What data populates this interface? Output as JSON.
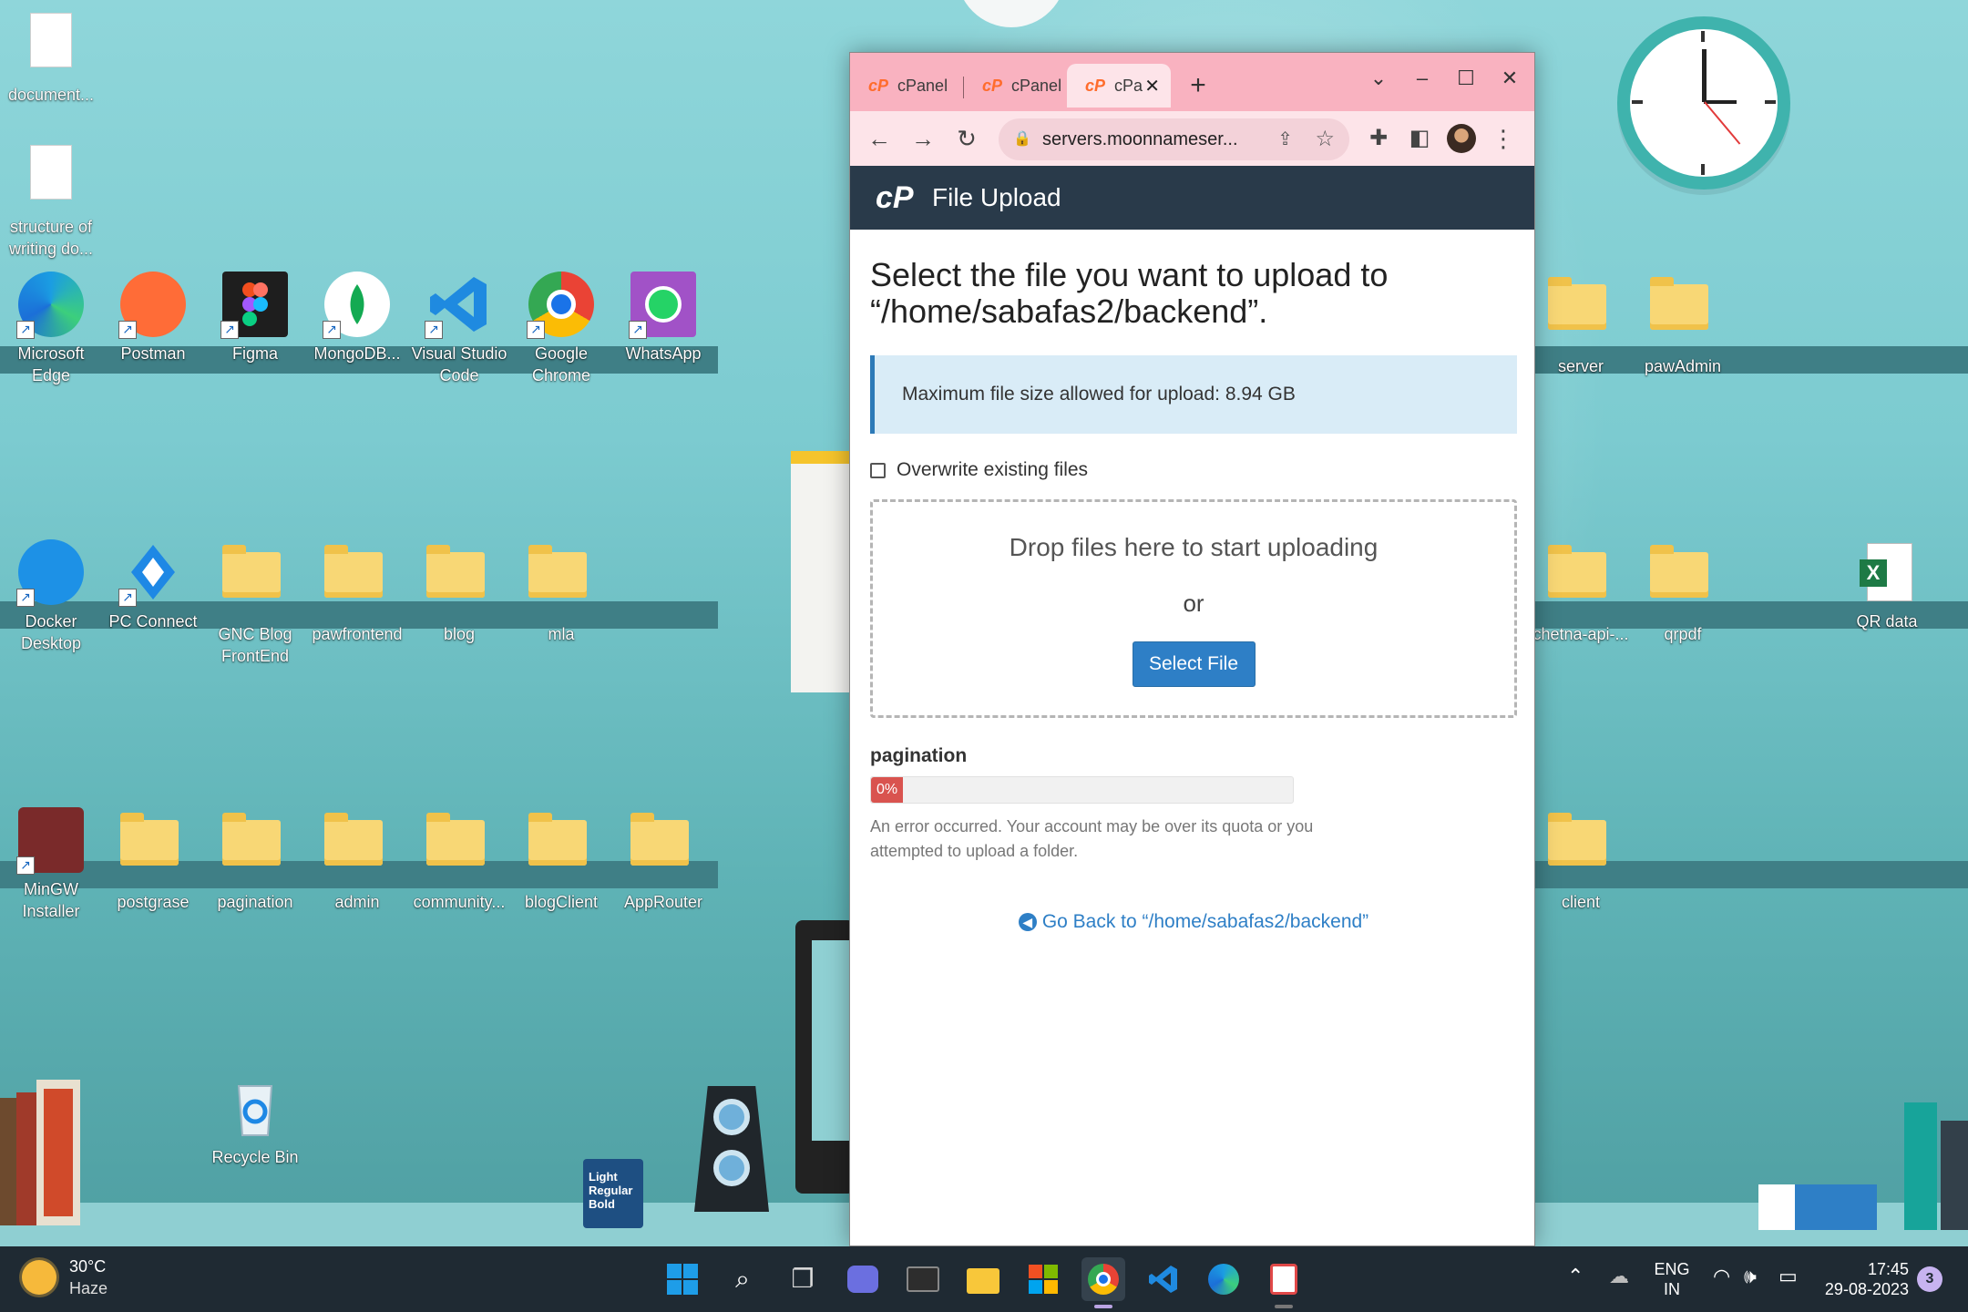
{
  "desktop": {
    "icons": [
      {
        "label": "document..."
      },
      {
        "label": "structure of writing do..."
      },
      {
        "label": "Microsoft Edge"
      },
      {
        "label": "Postman"
      },
      {
        "label": "Figma"
      },
      {
        "label": "MongoDB..."
      },
      {
        "label": "Visual Studio Code"
      },
      {
        "label": "Google Chrome"
      },
      {
        "label": "WhatsApp"
      },
      {
        "label": "Docker Desktop"
      },
      {
        "label": "PC Connect"
      },
      {
        "label": "GNC Blog FrontEnd"
      },
      {
        "label": "pawfrontend"
      },
      {
        "label": "blog"
      },
      {
        "label": "mla"
      },
      {
        "label": "MinGW Installer"
      },
      {
        "label": "postgrase"
      },
      {
        "label": "pagination"
      },
      {
        "label": "admin"
      },
      {
        "label": "community..."
      },
      {
        "label": "blogClient"
      },
      {
        "label": "AppRouter"
      },
      {
        "label": "Recycle Bin"
      },
      {
        "label": "server"
      },
      {
        "label": "pawAdmin"
      },
      {
        "label": "chetna-api-..."
      },
      {
        "label": "qrpdf"
      },
      {
        "label": "QR data"
      },
      {
        "label": "client"
      }
    ],
    "mug_text": [
      "Light",
      "Regular",
      "Bold"
    ]
  },
  "browser": {
    "tabs": [
      {
        "label": "cPanel"
      },
      {
        "label": "cPanel"
      },
      {
        "label": "cPa"
      }
    ],
    "new_tab": "+",
    "address": "servers.moonnameser...",
    "colors": {
      "titlebar": "#f9b2c0",
      "toolbar": "#fde4e9",
      "cpanel_header": "#293a4a",
      "accent": "#2e7fc6",
      "error": "#d9534f"
    }
  },
  "cpanel": {
    "header_title": "File Upload",
    "heading": "Select the file you want to upload to “/home/sabafas2/backend”.",
    "max_size": "Maximum file size allowed for upload: 8.94 GB",
    "overwrite_label": "Overwrite existing files",
    "overwrite_checked": false,
    "drop_text": "Drop files here to start uploading",
    "or_text": "or",
    "select_button": "Select File",
    "upload": {
      "filename": "pagination",
      "progress_label": "0%",
      "progress": 0,
      "error": "An error occurred. Your account may be over its quota or you attempted to upload a folder."
    },
    "go_back": "Go Back to “/home/sabafas2/backend”"
  },
  "taskbar": {
    "temperature": "30°C",
    "condition": "Haze",
    "language": "ENG",
    "region": "IN",
    "time": "17:45",
    "date": "29-08-2023",
    "notification_count": "3"
  }
}
